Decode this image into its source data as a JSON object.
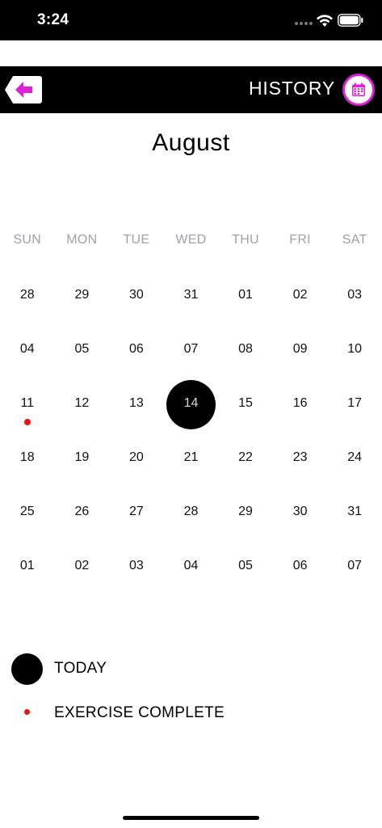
{
  "status_bar": {
    "time": "3:24"
  },
  "header": {
    "title": "HISTORY"
  },
  "calendar": {
    "month": "August",
    "weekdays": [
      "SUN",
      "MON",
      "TUE",
      "WED",
      "THU",
      "FRI",
      "SAT"
    ],
    "weeks": [
      [
        "28",
        "29",
        "30",
        "31",
        "01",
        "02",
        "03"
      ],
      [
        "04",
        "05",
        "06",
        "07",
        "08",
        "09",
        "10"
      ],
      [
        "11",
        "12",
        "13",
        "14",
        "15",
        "16",
        "17"
      ],
      [
        "18",
        "19",
        "20",
        "21",
        "22",
        "23",
        "24"
      ],
      [
        "25",
        "26",
        "27",
        "28",
        "29",
        "30",
        "31"
      ],
      [
        "01",
        "02",
        "03",
        "04",
        "05",
        "06",
        "07"
      ]
    ],
    "today": {
      "week": 2,
      "day": 3
    },
    "exercise_complete": [
      {
        "week": 2,
        "day": 0
      }
    ]
  },
  "legend": {
    "today_label": "TODAY",
    "exercise_label": "EXERCISE COMPLETE"
  },
  "colors": {
    "accent": "#e020d8",
    "exercise_dot": "#ee1111",
    "weekday_text": "#a0a0a6"
  }
}
